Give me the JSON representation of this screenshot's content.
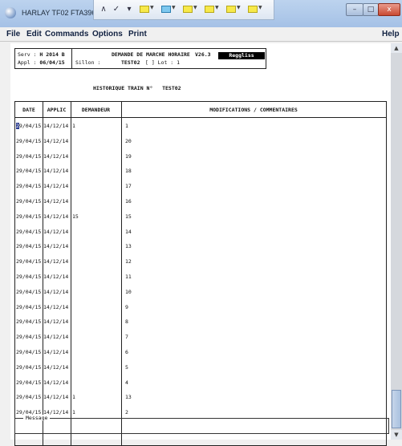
{
  "window": {
    "title": "HARLAY TF02 FTA3965",
    "controls": {
      "minimize": "–",
      "maximize": "□",
      "close": "x"
    }
  },
  "menu": {
    "items": [
      "File",
      "Edit",
      "Commands",
      "Options",
      "Print"
    ],
    "help": "Help"
  },
  "header": {
    "serv_label": "Serv :",
    "serv_value": "H 2014 B",
    "appl_label": "Appl :",
    "appl_value": "06/04/15",
    "title": "DEMANDE DE MARCHE HORAIRE",
    "version": "V26.3",
    "sillon_label": "Sillon :",
    "train": "TEST02",
    "lot_text": "[ ] Lot : 1",
    "badge": "Reggliss"
  },
  "history_title": "HISTORIQUE TRAIN N°",
  "history_train": "TEST02",
  "table": {
    "headers": [
      "DATE",
      "APPLIC",
      "DEMANDEUR",
      "MODIFICATIONS / COMMENTAIRES"
    ],
    "rows": [
      {
        "date": "29/04/15",
        "applic": "14/12/14",
        "demandeur": "1",
        "modif": "1"
      },
      {
        "date": "29/04/15",
        "applic": "14/12/14",
        "demandeur": "",
        "modif": "20"
      },
      {
        "date": "29/04/15",
        "applic": "14/12/14",
        "demandeur": "",
        "modif": "19"
      },
      {
        "date": "29/04/15",
        "applic": "14/12/14",
        "demandeur": "",
        "modif": "18"
      },
      {
        "date": "29/04/15",
        "applic": "14/12/14",
        "demandeur": "",
        "modif": "17"
      },
      {
        "date": "29/04/15",
        "applic": "14/12/14",
        "demandeur": "",
        "modif": "16"
      },
      {
        "date": "29/04/15",
        "applic": "14/12/14",
        "demandeur": "15",
        "modif": "15"
      },
      {
        "date": "29/04/15",
        "applic": "14/12/14",
        "demandeur": "",
        "modif": "14"
      },
      {
        "date": "29/04/15",
        "applic": "14/12/14",
        "demandeur": "",
        "modif": "13"
      },
      {
        "date": "29/04/15",
        "applic": "14/12/14",
        "demandeur": "",
        "modif": "12"
      },
      {
        "date": "29/04/15",
        "applic": "14/12/14",
        "demandeur": "",
        "modif": "11"
      },
      {
        "date": "29/04/15",
        "applic": "14/12/14",
        "demandeur": "",
        "modif": "10"
      },
      {
        "date": "29/04/15",
        "applic": "14/12/14",
        "demandeur": "",
        "modif": "9"
      },
      {
        "date": "29/04/15",
        "applic": "14/12/14",
        "demandeur": "",
        "modif": "8"
      },
      {
        "date": "29/04/15",
        "applic": "14/12/14",
        "demandeur": "",
        "modif": "7"
      },
      {
        "date": "29/04/15",
        "applic": "14/12/14",
        "demandeur": "",
        "modif": "6"
      },
      {
        "date": "29/04/15",
        "applic": "14/12/14",
        "demandeur": "",
        "modif": "5"
      },
      {
        "date": "29/04/15",
        "applic": "14/12/14",
        "demandeur": "",
        "modif": "4"
      },
      {
        "date": "29/04/15",
        "applic": "14/12/14",
        "demandeur": "1",
        "modif": "13"
      },
      {
        "date": "29/04/15",
        "applic": "14/12/14",
        "demandeur": "1",
        "modif": "2"
      }
    ]
  },
  "message_label": "Message",
  "icons": [
    "app-icon",
    "caret-up-icon",
    "caret-down-icon",
    "check-icon",
    "note-icon",
    "scroll-up-icon",
    "scroll-down-icon"
  ]
}
